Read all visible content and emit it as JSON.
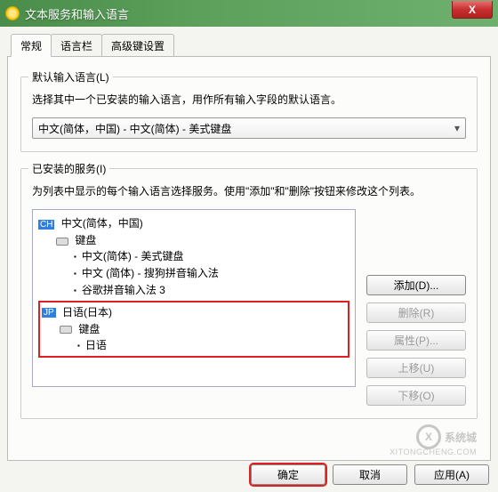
{
  "window": {
    "title": "文本服务和输入语言",
    "close": "X"
  },
  "tabs": {
    "general": "常规",
    "langbar": "语言栏",
    "hotkey": "高级键设置"
  },
  "default_group": {
    "title": "默认输入语言(L)",
    "desc": "选择其中一个已安装的输入语言，用作所有输入字段的默认语言。",
    "selected": "中文(简体，中国) - 中文(简体) - 美式键盘"
  },
  "installed_group": {
    "title": "已安装的服务(I)",
    "desc": "为列表中显示的每个输入语言选择服务。使用\"添加\"和\"删除\"按钮来修改这个列表。"
  },
  "tree": {
    "ch_badge": "CH",
    "ch_name": "中文(简体，中国)",
    "keyboard": "键盘",
    "ch_items": [
      "中文(简体) - 美式键盘",
      "中文 (简体) - 搜狗拼音输入法",
      "谷歌拼音输入法 3"
    ],
    "jp_badge": "JP",
    "jp_name": "日语(日本)",
    "jp_item": "日语"
  },
  "side_buttons": {
    "add": "添加(D)...",
    "remove": "删除(R)",
    "props": "属性(P)...",
    "moveup": "上移(U)",
    "movedown": "下移(O)"
  },
  "bottom": {
    "ok": "确定",
    "cancel": "取消",
    "apply": "应用(A)"
  },
  "watermark": {
    "text": "系统城",
    "url": "XITONGCHENG.COM"
  }
}
